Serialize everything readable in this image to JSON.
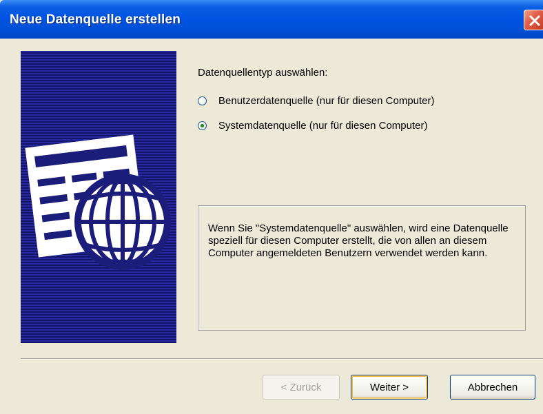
{
  "window": {
    "title": "Neue Datenquelle erstellen"
  },
  "main": {
    "prompt": "Datenquellentyp auswählen:",
    "options": [
      {
        "label": "Benutzerdatenquelle (nur für diesen Computer)",
        "checked": false
      },
      {
        "label": "Systemdatenquelle (nur für diesen Computer)",
        "checked": true
      }
    ],
    "description": "Wenn Sie \"Systemdatenquelle\" auswählen, wird eine Datenquelle speziell für diesen Computer erstellt, die von allen an diesem Computer angemeldeten Benutzern verwendet werden kann."
  },
  "buttons": {
    "back": "< Zurück",
    "next": "Weiter >",
    "cancel": "Abbrechen"
  },
  "icons": {
    "close": "close-icon",
    "banner": "data-source-globe-icon"
  },
  "colors": {
    "titlebar": "#0054e3",
    "banner": "#1c1c7a",
    "selected_radio": "#21a121",
    "close": "#e2614a"
  }
}
